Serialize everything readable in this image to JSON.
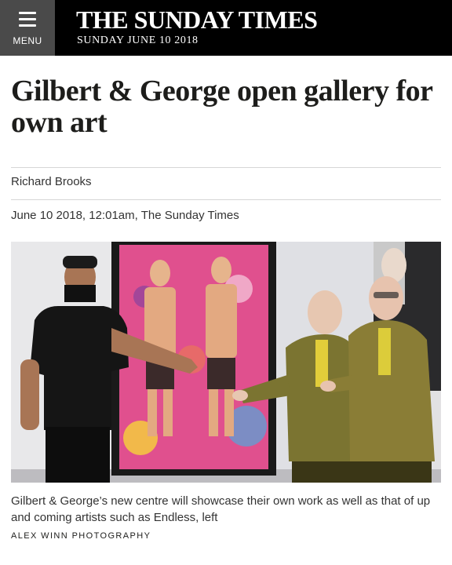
{
  "masthead": {
    "menu_label": "MENU",
    "brand": "THE SUNDAY TIMES",
    "date": "SUNDAY JUNE 10 2018"
  },
  "article": {
    "headline": "Gilbert & George open gallery for own art",
    "byline": "Richard Brooks",
    "dateline": "June 10 2018, 12:01am, The Sunday Times"
  },
  "photo": {
    "caption": "Gilbert & George’s new centre will showcase their own work as well as that of up and coming artists such as Endless, left",
    "credit": "ALEX WINN PHOTOGRAPHY"
  },
  "icons": {
    "menu": "hamburger-menu-icon"
  },
  "colors": {
    "masthead_bg": "#000000",
    "menu_bg": "#4a4a4a",
    "text": "#1d1d1b",
    "rule": "#d6d6d6",
    "painting_pink": "#e0508e"
  }
}
